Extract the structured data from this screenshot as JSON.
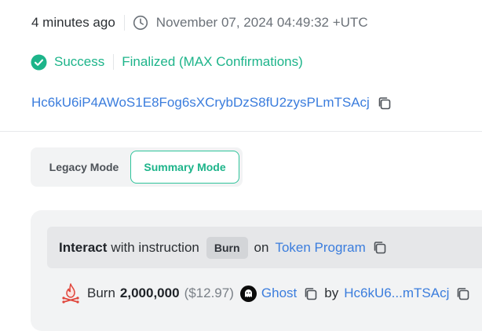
{
  "tx": {
    "time_ago": "4 minutes ago",
    "timestamp": "November 07, 2024 04:49:32 +UTC",
    "status": "Success",
    "finality": "Finalized (MAX Confirmations)",
    "signer": "Hc6kU6iP4AWoS1E8Fog6sXCrybDzS8fU2zysPLmTSAcj"
  },
  "mode": {
    "legacy_label": "Legacy Mode",
    "summary_label": "Summary Mode",
    "active": "Summary Mode"
  },
  "instruction": {
    "verb": "Interact",
    "with_text": "with instruction",
    "badge": "Burn",
    "on_text": "on",
    "program": "Token Program"
  },
  "burn": {
    "label": "Burn",
    "amount": "2,000,000",
    "usd": "($12.97)",
    "token": "Ghost",
    "by_text": "by",
    "by_account": "Hc6kU6...mTSAcj"
  },
  "colors": {
    "success_green": "#1db48a",
    "link_blue": "#3b7ddd",
    "burn_red": "#e0463c"
  },
  "icons": [
    "clock-icon",
    "success-check-icon",
    "copy-icon",
    "fire-icon",
    "ghost-token-logo"
  ]
}
